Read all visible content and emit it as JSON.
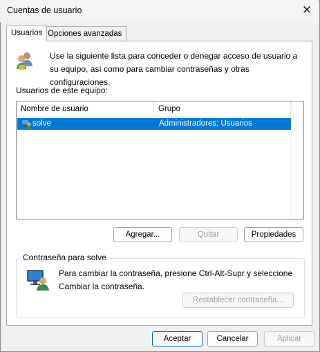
{
  "window": {
    "title": "Cuentas de usuario",
    "close_glyph": "✕"
  },
  "tabs": [
    {
      "label": "Usuarios",
      "active": true
    },
    {
      "label": "Opciones avanzadas",
      "active": false
    }
  ],
  "intro": {
    "icon": "users-icon",
    "text": "Use la siguiente lista para conceder o denegar acceso de usuario a su equipo, así como para cambiar contraseñas y otras configuraciones."
  },
  "users_section": {
    "label": "Usuarios de este equipo:",
    "columns": [
      "Nombre de usuario",
      "Grupo"
    ],
    "rows": [
      {
        "icon": "user-account-icon",
        "name": "solve",
        "group": "Administradores; Usuarios",
        "selected": true
      }
    ]
  },
  "list_buttons": {
    "add": "Agregar...",
    "remove": "Quitar",
    "properties": "Propiedades"
  },
  "password_group": {
    "legend": "Contraseña para solve",
    "icon": "password-computer-icon",
    "text": "Para cambiar la contraseña, presione Ctrl-Alt-Supr y seleccione Cambiar la contraseña.",
    "reset_button": "Restablecer contraseña..."
  },
  "footer": {
    "ok": "Aceptar",
    "cancel": "Cancelar",
    "apply": "Aplicar"
  },
  "colors": {
    "selection": "#0078d7",
    "default_button_border": "#0067c0"
  }
}
